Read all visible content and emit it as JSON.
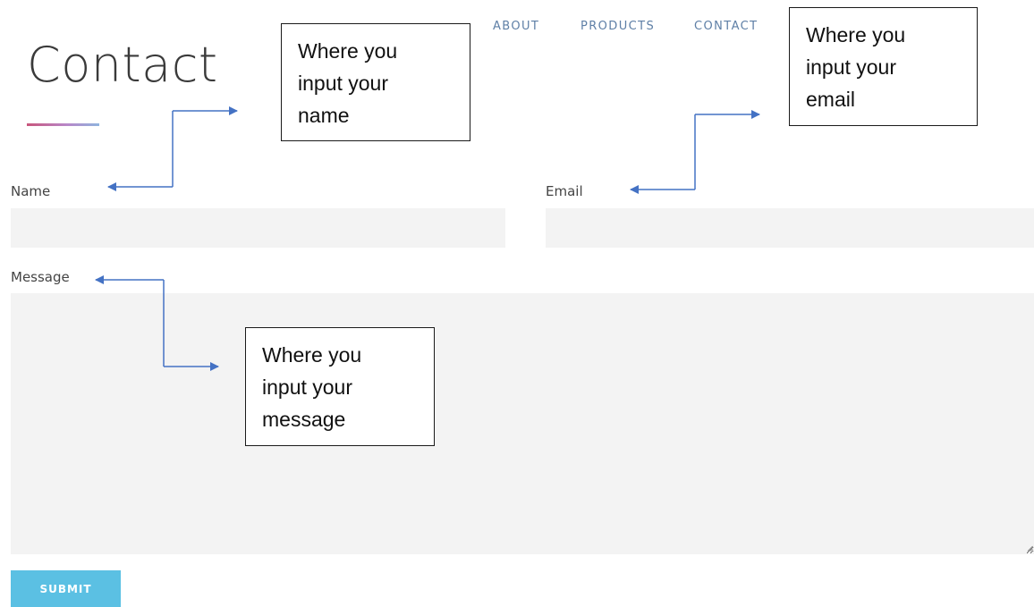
{
  "nav": {
    "items": [
      {
        "label": "ABOUT"
      },
      {
        "label": "PRODUCTS"
      },
      {
        "label": "CONTACT"
      }
    ]
  },
  "page": {
    "title": "Contact"
  },
  "form": {
    "name_label": "Name",
    "name_value": "",
    "email_label": "Email",
    "email_value": "",
    "message_label": "Message",
    "message_value": "",
    "submit_label": "SUBMIT",
    "submit_color": "#5bc0e3",
    "field_background": "#f3f3f3"
  },
  "annotations": {
    "name_callout": "Where you\ninput your\nname",
    "email_callout": "Where you\ninput your\nemail",
    "message_callout": "Where you\ninput your\nmessage",
    "arrow_color": "#4472c4"
  }
}
